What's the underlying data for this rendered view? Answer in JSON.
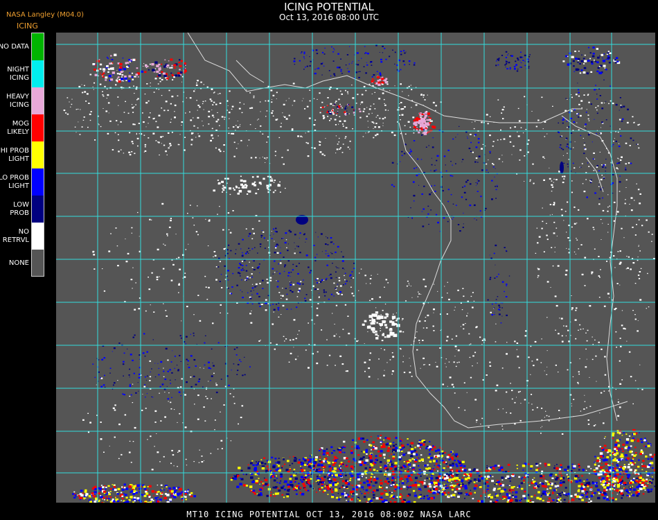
{
  "header": {
    "source": "NASA Langley (M04.0)",
    "title": "ICING POTENTIAL",
    "subtitle": "Oct 13, 2016 08:00 UTC",
    "legend_title": "ICING"
  },
  "legend": [
    {
      "lines": [
        "NO DATA"
      ],
      "color": "#00b400"
    },
    {
      "lines": [
        "NIGHT",
        "ICING"
      ],
      "color": "#00eeee"
    },
    {
      "lines": [
        "HEAVY",
        "ICING"
      ],
      "color": "#e8a8d8"
    },
    {
      "lines": [
        "MOG",
        "LIKELY"
      ],
      "color": "#ff0000"
    },
    {
      "lines": [
        "HI PROB",
        "LIGHT"
      ],
      "color": "#ffff00"
    },
    {
      "lines": [
        "LO PROB",
        "LIGHT"
      ],
      "color": "#0000ff"
    },
    {
      "lines": [
        "LOW",
        "PROB"
      ],
      "color": "#000080"
    },
    {
      "lines": [
        "NO",
        "RETRVL"
      ],
      "color": "#ffffff"
    },
    {
      "lines": [
        "NONE"
      ],
      "color": "#555555"
    }
  ],
  "map": {
    "background": "#555555",
    "grid_color": "#33dddd",
    "coast_color": "#dddddd"
  },
  "footer": "MT10  ICING POTENTIAL   OCT 13, 2016 08:00Z   NASA LARC"
}
